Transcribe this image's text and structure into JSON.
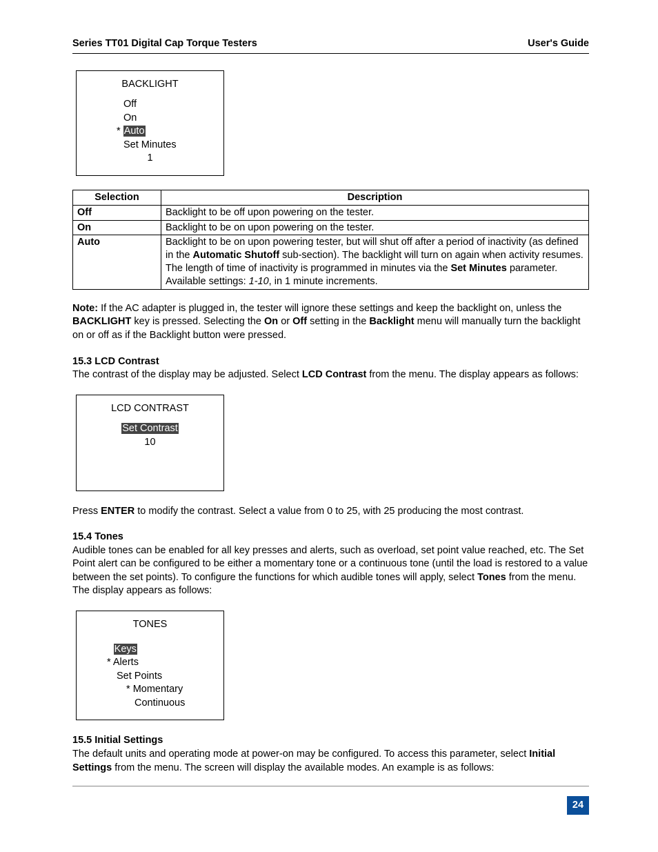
{
  "header": {
    "left": "Series TT01 Digital Cap Torque Testers",
    "right": "User's Guide"
  },
  "lcd_backlight": {
    "title": "BACKLIGHT",
    "r1": "Off",
    "r2": "On",
    "r3_marker": "*",
    "r3": "Auto",
    "r4": "Set Minutes",
    "r5": "1"
  },
  "table": {
    "h1": "Selection",
    "h2": "Description",
    "rows": [
      {
        "sel": "Off",
        "desc_plain": "Backlight to be off upon powering on the tester."
      },
      {
        "sel": "On",
        "desc_plain": "Backlight to be on upon powering on the tester."
      },
      {
        "sel": "Auto",
        "desc": {
          "pre": "Backlight to be on upon powering tester, but will shut off after a period of inactivity (as defined in the ",
          "b1": "Automatic Shutoff",
          "mid1": " sub-section). The backlight will turn on again when activity resumes. The length of time of inactivity is programmed in minutes via the ",
          "b2": "Set Minutes",
          "mid2": " parameter. Available settings: ",
          "i1": "1-10",
          "post": ", in 1 minute increments."
        }
      }
    ]
  },
  "note": {
    "label": "Note:",
    "t1": " If the AC adapter is plugged in, the tester will ignore these settings and keep the backlight on, unless the ",
    "b1": "BACKLIGHT",
    "t2": " key is pressed. Selecting the ",
    "b2": "On",
    "t3": " or ",
    "b3": "Off",
    "t4": " setting in the ",
    "b4": "Backlight",
    "t5": " menu will manually turn the backlight on or off as if the Backlight button were pressed."
  },
  "s153": {
    "head": "15.3 LCD Contrast",
    "t1": "The contrast of the display may be adjusted. Select ",
    "b1": "LCD Contrast",
    "t2": " from the menu. The display appears as follows:"
  },
  "lcd_contrast": {
    "title": "LCD CONTRAST",
    "r1": "Set Contrast",
    "r2": "10"
  },
  "s153b": {
    "t1": "Press ",
    "b1": "ENTER",
    "t2": " to modify the contrast. Select a value from 0 to 25, with 25 producing the most contrast."
  },
  "s154": {
    "head": "15.4 Tones",
    "t1": "Audible tones can be enabled for all key presses and alerts, such as overload, set point value reached, etc. The Set Point alert can be configured to be either a momentary tone or a continuous tone (until the load is restored to a value between the set points). To configure the functions for which audible tones will apply, select ",
    "b1": "Tones",
    "t2": " from the menu. The display appears as follows:"
  },
  "lcd_tones": {
    "title": "TONES",
    "r1": "Keys",
    "r2m": "*",
    "r2": "Alerts",
    "r3": "Set Points",
    "r4m": "*",
    "r4": "Momentary",
    "r5": "Continuous"
  },
  "s155": {
    "head": "15.5 Initial Settings",
    "t1": "The default units and operating mode at power-on may be configured. To access this parameter, select ",
    "b1": "Initial Settings",
    "t2": " from the menu. The screen will display the available modes. An example is as follows:"
  },
  "page_number": "24"
}
